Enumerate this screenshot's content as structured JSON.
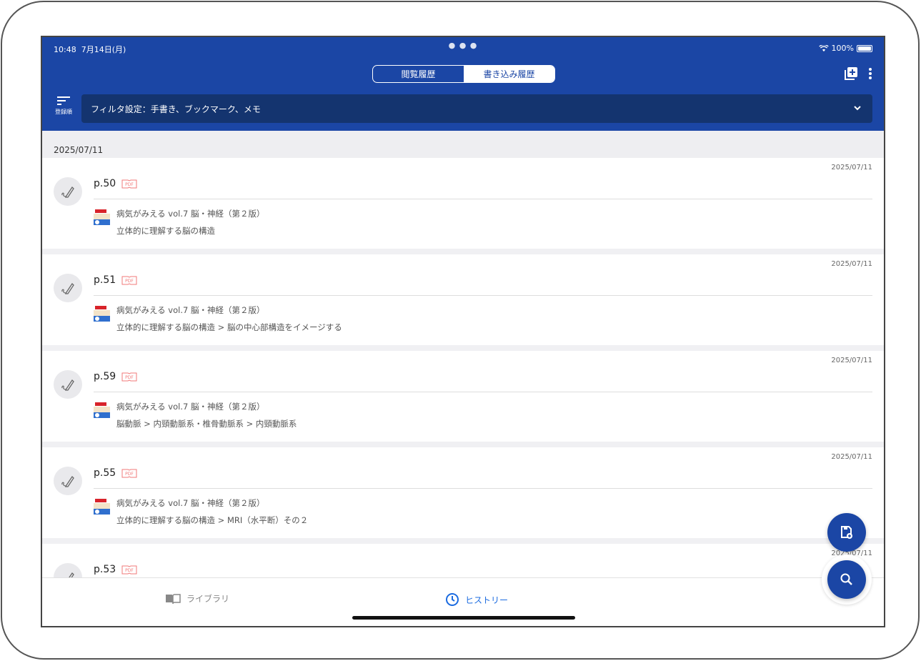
{
  "status_bar": {
    "time": "10:48",
    "date": "7月14日(月)",
    "battery": "100%"
  },
  "tabs": {
    "view_history": "閲覧履歴",
    "write_history": "書き込み履歴"
  },
  "toolbar": {
    "sort_label": "登録順",
    "filter_text": "フィルタ設定：手書き、ブックマーク、メモ"
  },
  "date_group": "2025/07/11",
  "entries": [
    {
      "date": "2025/07/11",
      "page": "p.50",
      "book": "病気がみえる vol.7 脳・神経（第２版）",
      "chapter": "立体的に理解する脳の構造"
    },
    {
      "date": "2025/07/11",
      "page": "p.51",
      "book": "病気がみえる vol.7 脳・神経（第２版）",
      "chapter": "立体的に理解する脳の構造 > 脳の中心部構造をイメージする"
    },
    {
      "date": "2025/07/11",
      "page": "p.59",
      "book": "病気がみえる vol.7 脳・神経（第２版）",
      "chapter": "脳動脈 > 内頸動脈系・椎骨動脈系 > 内頸動脈系"
    },
    {
      "date": "2025/07/11",
      "page": "p.55",
      "book": "病気がみえる vol.7 脳・神経（第２版）",
      "chapter": "立体的に理解する脳の構造 > MRI（水平断）その２"
    },
    {
      "date": "2025/07/11",
      "page": "p.53",
      "book": "",
      "chapter": ""
    }
  ],
  "pdf_badge": "PDF",
  "bottom_nav": {
    "library": "ライブラリ",
    "history": "ヒストリー"
  },
  "colors": {
    "primary": "#1b46a5",
    "filter_bg": "#14346f",
    "active_tab": "#1b6be0",
    "pdf_red": "#f07a7a"
  }
}
